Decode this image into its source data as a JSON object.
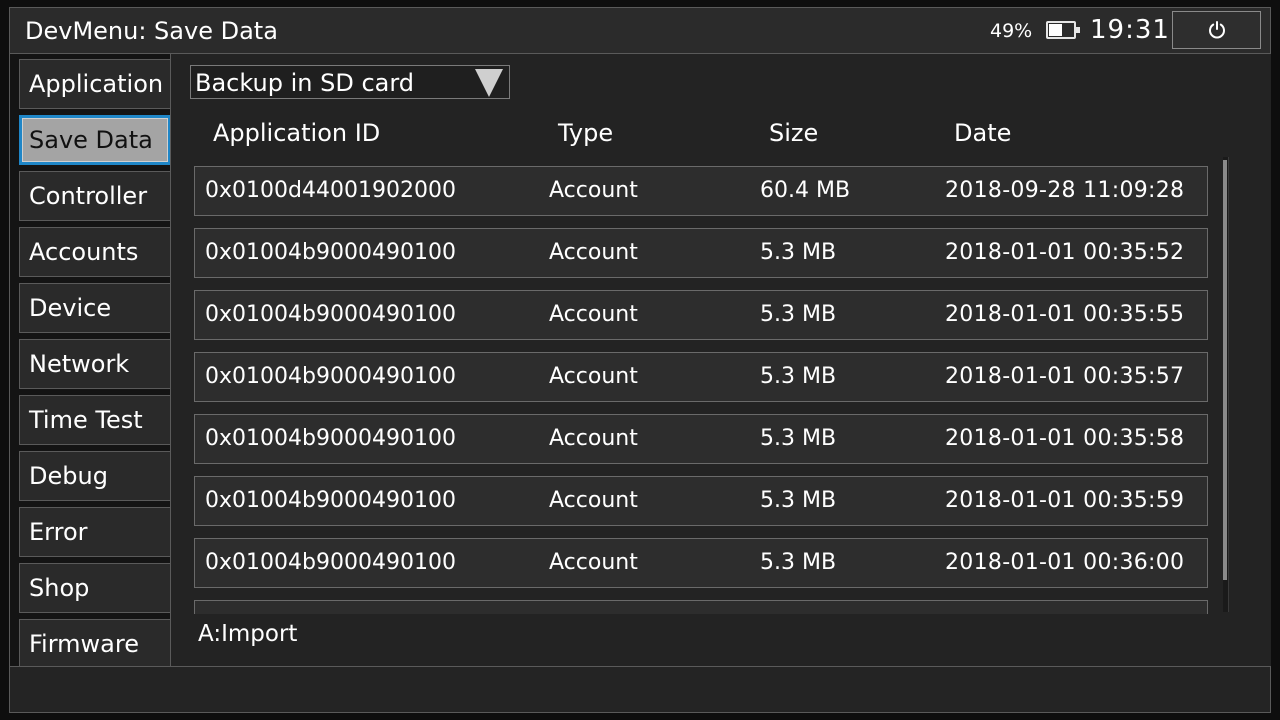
{
  "header": {
    "title": "DevMenu: Save Data",
    "battery_percent": "49%",
    "battery_level": 0.49,
    "clock": "19:31",
    "power_icon": "power-icon"
  },
  "sidebar": {
    "items": [
      {
        "label": "Application"
      },
      {
        "label": "Save Data",
        "selected": true
      },
      {
        "label": "Controller"
      },
      {
        "label": "Accounts"
      },
      {
        "label": "Device"
      },
      {
        "label": "Network"
      },
      {
        "label": "Time Test"
      },
      {
        "label": "Debug"
      },
      {
        "label": "Error"
      },
      {
        "label": "Shop"
      },
      {
        "label": "Firmware"
      }
    ]
  },
  "filter": {
    "selected": "Backup in SD card"
  },
  "table": {
    "columns": [
      "Application ID",
      "Type",
      "Size",
      "Date"
    ],
    "rows": [
      {
        "id": "0x0100d44001902000",
        "type": "Account",
        "size": "60.4 MB",
        "date": "2018-09-28 11:09:28"
      },
      {
        "id": "0x01004b9000490100",
        "type": "Account",
        "size": "5.3 MB",
        "date": "2018-01-01 00:35:52"
      },
      {
        "id": "0x01004b9000490100",
        "type": "Account",
        "size": "5.3 MB",
        "date": "2018-01-01 00:35:55"
      },
      {
        "id": "0x01004b9000490100",
        "type": "Account",
        "size": "5.3 MB",
        "date": "2018-01-01 00:35:57"
      },
      {
        "id": "0x01004b9000490100",
        "type": "Account",
        "size": "5.3 MB",
        "date": "2018-01-01 00:35:58"
      },
      {
        "id": "0x01004b9000490100",
        "type": "Account",
        "size": "5.3 MB",
        "date": "2018-01-01 00:35:59"
      },
      {
        "id": "0x01004b9000490100",
        "type": "Account",
        "size": "5.3 MB",
        "date": "2018-01-01 00:36:00"
      },
      {
        "id": "",
        "type": "",
        "size": "",
        "date": ""
      }
    ]
  },
  "hint": "A:Import",
  "colors": {
    "selection_border": "#1f86c7",
    "selection_bg": "#a4a4a4"
  }
}
